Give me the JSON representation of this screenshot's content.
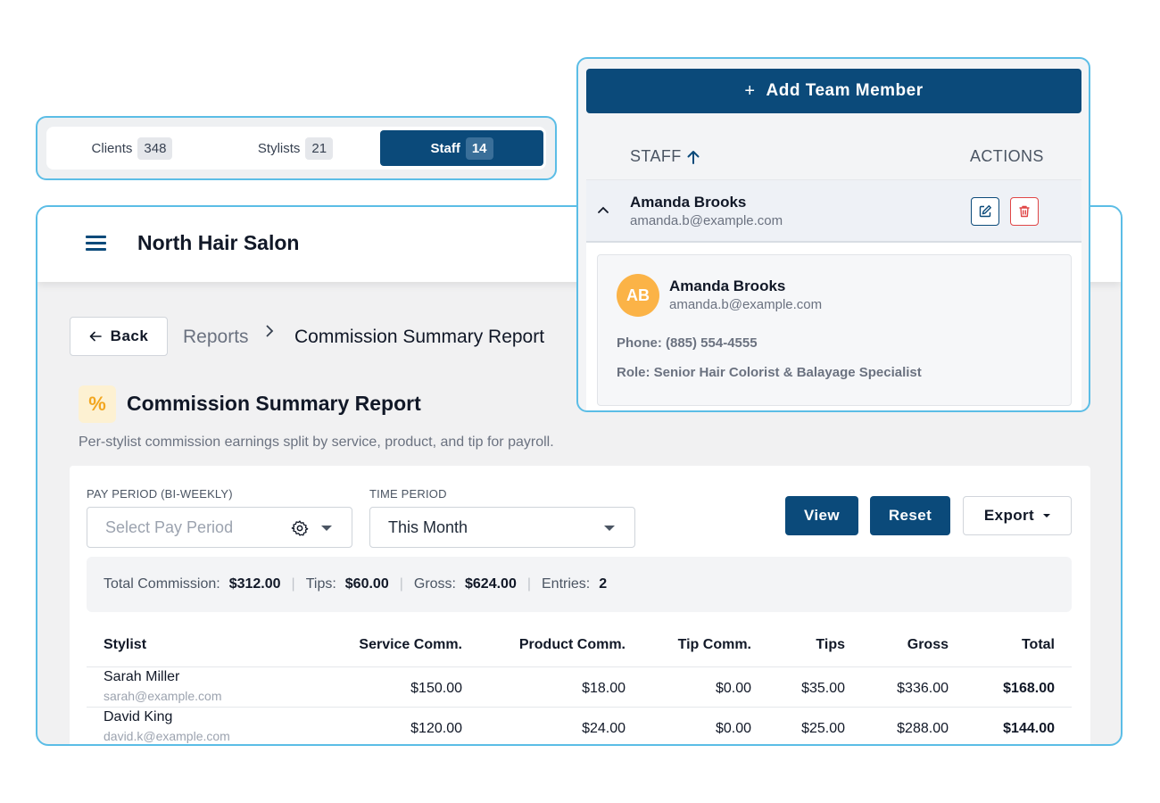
{
  "segments": [
    {
      "label": "Clients",
      "count": "348"
    },
    {
      "label": "Stylists",
      "count": "21"
    },
    {
      "label": "Staff",
      "count": "14",
      "active": true
    }
  ],
  "app": {
    "title": "North Hair Salon"
  },
  "breadcrumb": {
    "back_label": "Back",
    "parent": "Reports",
    "current": "Commission Summary Report"
  },
  "report": {
    "title": "Commission Summary Report",
    "description": "Per-stylist commission earnings split by service, product, and tip for payroll.",
    "icon": "%"
  },
  "filters": {
    "pay_period_label": "PAY PERIOD (BI-WEEKLY)",
    "pay_period_placeholder": "Select Pay Period",
    "time_period_label": "TIME PERIOD",
    "time_period_value": "This Month"
  },
  "actions": {
    "view": "View",
    "reset": "Reset",
    "export": "Export"
  },
  "summary": {
    "total_commission_label": "Total Commission:",
    "total_commission": "$312.00",
    "tips_label": "Tips:",
    "tips": "$60.00",
    "gross_label": "Gross:",
    "gross": "$624.00",
    "entries_label": "Entries:",
    "entries": "2",
    "separator": "|"
  },
  "table": {
    "columns": [
      "Stylist",
      "Service Comm.",
      "Product Comm.",
      "Tip Comm.",
      "Tips",
      "Gross",
      "Total"
    ],
    "rows": [
      {
        "name": "Sarah Miller",
        "email": "sarah@example.com",
        "service": "$150.00",
        "product": "$18.00",
        "tip_comm": "$0.00",
        "tips": "$35.00",
        "gross": "$336.00",
        "total": "$168.00"
      },
      {
        "name": "David King",
        "email": "david.k@example.com",
        "service": "$120.00",
        "product": "$24.00",
        "tip_comm": "$0.00",
        "tips": "$25.00",
        "gross": "$288.00",
        "total": "$144.00"
      }
    ]
  },
  "team": {
    "add_label": "Add Team Member",
    "add_icon": "+",
    "col_staff": "STAFF",
    "col_actions": "ACTIONS",
    "member": {
      "name": "Amanda Brooks",
      "email": "amanda.b@example.com",
      "initials": "AB",
      "phone": "Phone: (885) 554-4555",
      "role": "Role: Senior Hair Colorist & Balayage Specialist"
    }
  },
  "colors": {
    "primary": "#0b4a7a",
    "accent_border": "#5bbde6",
    "avatar": "#fbb347",
    "danger": "#e04646",
    "icon_accent": "#f2a61f"
  }
}
